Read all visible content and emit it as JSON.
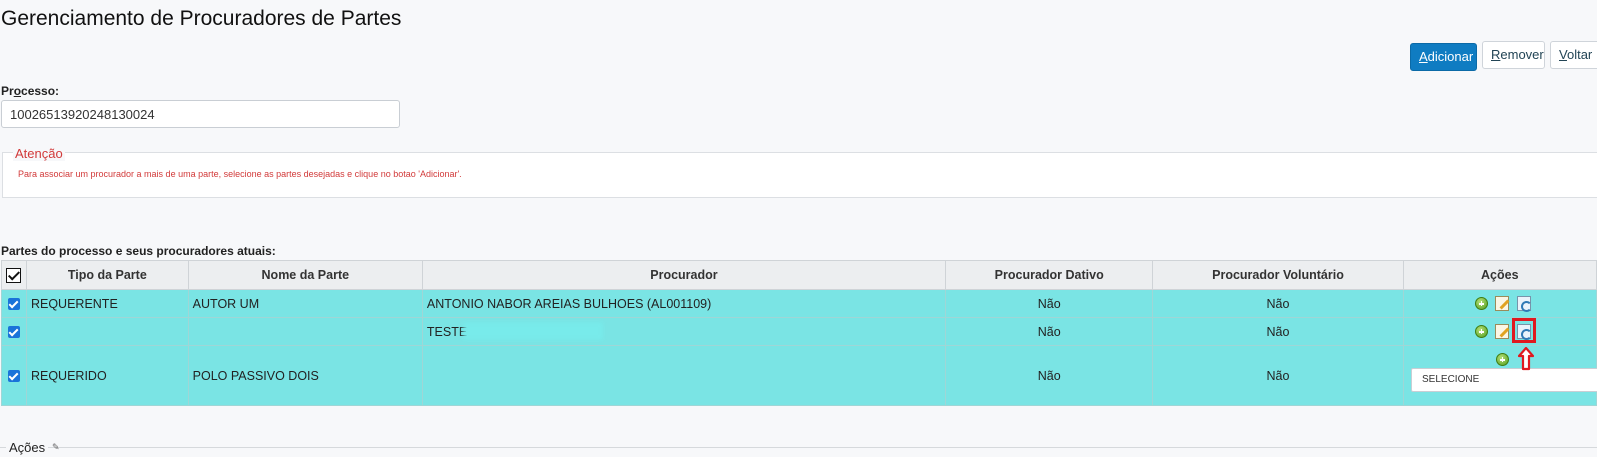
{
  "page": {
    "title": "Gerenciamento de Procuradores de Partes"
  },
  "toolbar": {
    "add_mnemonic": "A",
    "add_rest": "dicionar",
    "remove_mnemonic": "R",
    "remove_rest": "emover",
    "back_mnemonic": "V",
    "back_rest": "oltar"
  },
  "processo": {
    "label_pre": "Pr",
    "label_mn": "o",
    "label_post": "cesso:",
    "value": "10026513920248130024"
  },
  "atencao": {
    "legend": "Atenção",
    "text": "Para associar um procurador a mais de uma parte, selecione as partes desejadas e clique no botao 'Adicionar'."
  },
  "partes": {
    "section_label": "Partes do processo e seus procuradores atuais:",
    "columns": [
      "Tipo da Parte",
      "Nome da Parte",
      "Procurador",
      "Procurador Dativo",
      "Procurador Voluntário",
      "Ações"
    ],
    "rows": [
      {
        "tipo": "REQUERENTE",
        "nome": "AUTOR UM",
        "procurador": "ANTONIO NABOR AREIAS BULHOES (AL001109)",
        "dativo": "Não",
        "voluntario": "Não"
      },
      {
        "tipo": "",
        "nome": "",
        "procurador": "TESTE",
        "dativo": "Não",
        "voluntario": "Não"
      },
      {
        "tipo": "REQUERIDO",
        "nome": "POLO PASSIVO DOIS",
        "procurador": "",
        "dativo": "Não",
        "voluntario": "Não"
      }
    ],
    "select_value": "SELECIONE"
  },
  "acoes_section": {
    "legend": "Ações"
  },
  "colors": {
    "row_bg": "#7ae4e4",
    "primary": "#0f7cc2",
    "attention": "#d23a3a",
    "highlight": "#e0191f"
  }
}
